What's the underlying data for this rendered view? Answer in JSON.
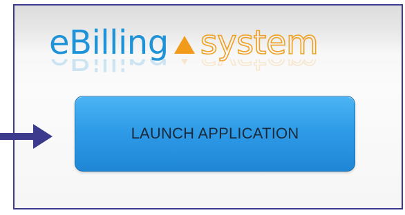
{
  "logo": {
    "part1": "eBilling",
    "part2": "system",
    "colors": {
      "ebilling": "#1f93d8",
      "system": "#f0a020",
      "triangle": "#f29b1a"
    }
  },
  "launch_button": {
    "label": "LAUNCH APPLICATION",
    "color": "#2f9ce8"
  },
  "pointer_arrow": {
    "icon": "arrow-right-icon",
    "color": "#3b3a8c"
  },
  "frame": {
    "border_color": "#3b3a8c"
  }
}
